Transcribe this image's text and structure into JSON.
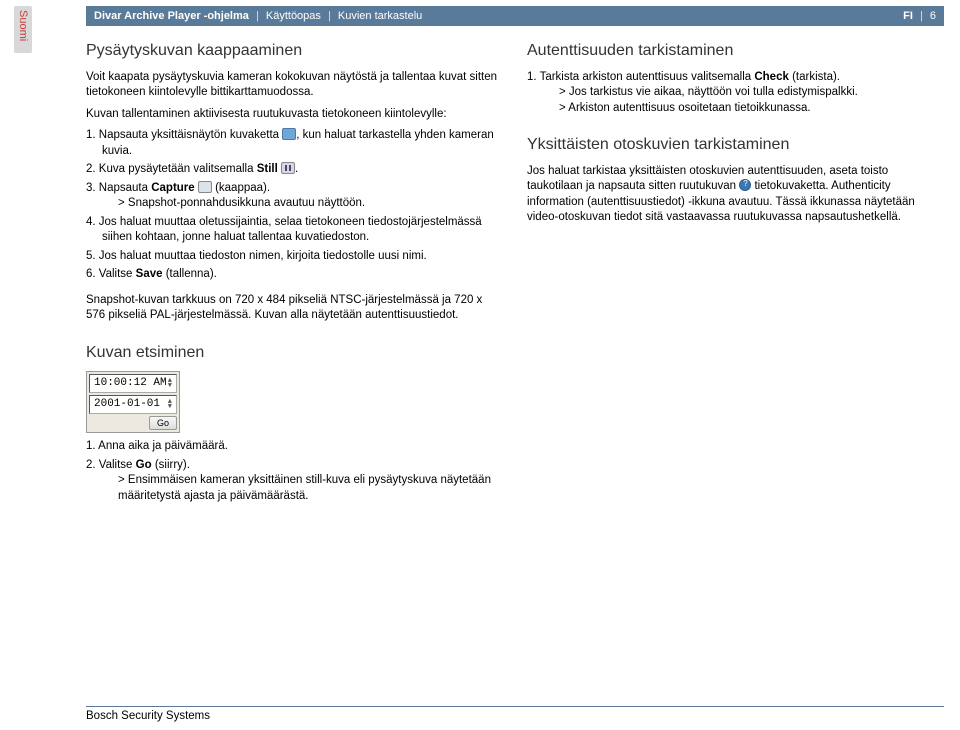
{
  "sidebar": {
    "language": "Suomi"
  },
  "header": {
    "product": "Divar Archive Player -ohjelma",
    "crumb1": "Käyttöopas",
    "crumb2": "Kuvien tarkastelu",
    "lang": "FI",
    "page": "6"
  },
  "left": {
    "h_capture": "Pysäytyskuvan kaappaaminen",
    "p_intro": "Voit kaapata pysäytyskuvia kameran kokokuvan näytöstä ja tallentaa kuvat sitten tietokoneen kiintolevylle bittikarttamuodossa.",
    "p_save": "Kuvan tallentaminen aktiivisesta ruutukuvasta tietokoneen kiintolevylle:",
    "s1a": "1. Napsauta yksittäisnäytön kuvaketta ",
    "s1b": ", kun haluat tarkastella yhden kameran kuvia.",
    "s2a": "2. Kuva pysäytetään valitsemalla ",
    "s2b": "Still",
    "s2c": ".",
    "s3a": "3. Napsauta ",
    "s3b": "Capture",
    "s3c": " (kaappaa).",
    "s3sub": "> Snapshot-ponnahdusikkuna avautuu näyttöön.",
    "s4": "4. Jos haluat muuttaa oletussijaintia, selaa tietokoneen tiedostojärjestelmässä siihen kohtaan, jonne haluat tallentaa kuvatiedoston.",
    "s5": "5. Jos haluat muuttaa tiedoston nimen, kirjoita tiedostolle uusi nimi.",
    "s6a": "6. Valitse ",
    "s6b": "Save",
    "s6c": " (tallenna).",
    "p_res": "Snapshot-kuvan tarkkuus on 720 x 484 pikseliä NTSC-järjestelmässä ja 720 x 576 pikseliä PAL-järjestelmässä. Kuvan alla näytetään autenttisuustiedot.",
    "h_search": "Kuvan etsiminen",
    "time": "10:00:12 AM",
    "date": "2001-01-01",
    "go": "Go",
    "q1": "1. Anna aika ja päivämäärä.",
    "q2a": "2. Valitse ",
    "q2b": "Go",
    "q2c": " (siirry).",
    "q2sub": "> Ensimmäisen kameran yksittäinen still-kuva eli pysäytyskuva näytetään määritetystä ajasta ja päivämäärästä."
  },
  "right": {
    "h_auth": "Autenttisuuden tarkistaminen",
    "a1a": "1. Tarkista arkiston autenttisuus valitsemalla ",
    "a1b": "Check",
    "a1c": " (tarkista).",
    "a1sub1": "> Jos tarkistus vie aikaa, näyttöön voi tulla edistymispalkki.",
    "a1sub2": "> Arkiston autenttisuus osoitetaan tietoikkunassa.",
    "h_single": "Yksittäisten otoskuvien tarkistaminen",
    "p_single_a": "Jos haluat tarkistaa yksittäisten otoskuvien autenttisuuden, aseta toisto taukotilaan ja napsauta sitten ruutukuvan ",
    "p_single_b": " tietokuvaketta. Authenticity information (autenttisuustiedot) -ikkuna avautuu. Tässä ikkunassa näytetään video-otoskuvan tiedot sitä vastaavassa ruutukuvassa napsautushetkellä."
  },
  "footer": {
    "company": "Bosch Security Systems"
  }
}
